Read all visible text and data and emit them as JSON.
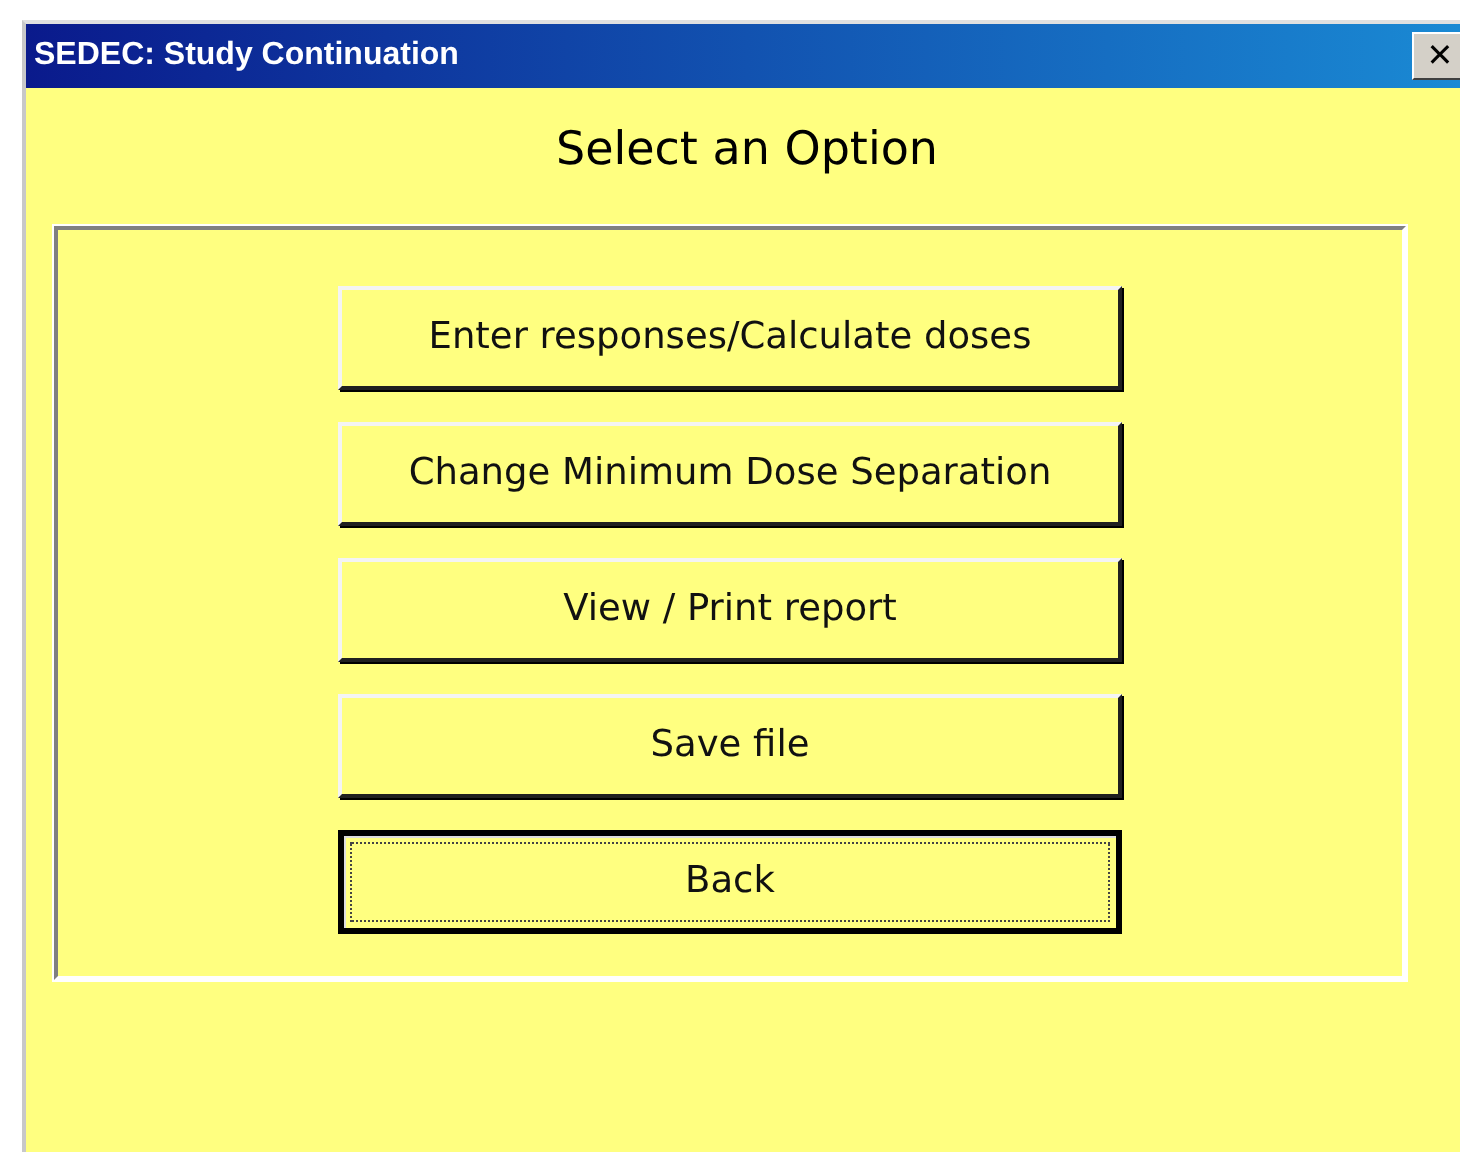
{
  "window": {
    "title": "SEDEC: Study Continuation",
    "close": "✕"
  },
  "heading": "Select an Option",
  "buttons": [
    {
      "label": "Enter responses/Calculate doses",
      "focused": false
    },
    {
      "label": "Change Minimum Dose Separation",
      "focused": false
    },
    {
      "label": "View / Print report",
      "focused": false
    },
    {
      "label": "Save file",
      "focused": false
    },
    {
      "label": "Back",
      "focused": true
    }
  ]
}
